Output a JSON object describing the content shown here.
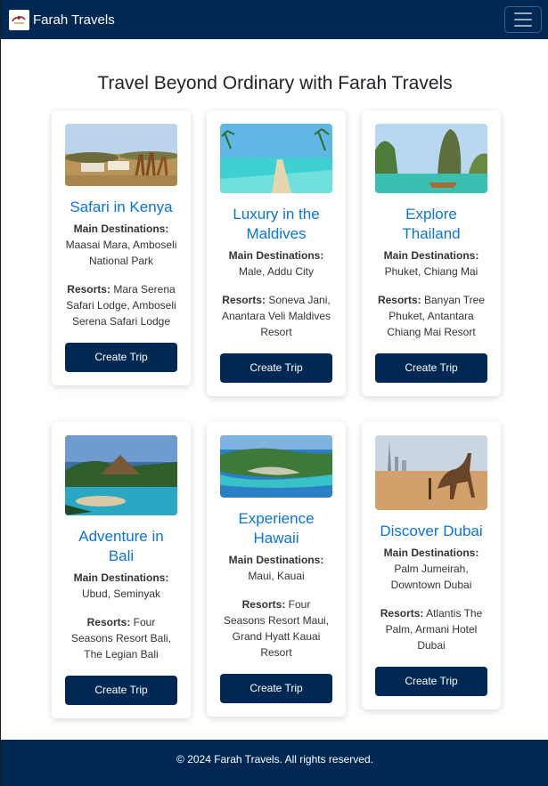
{
  "navbar": {
    "brand": "Farah Travels",
    "toggle_icon": "hamburger-icon"
  },
  "page_title": "Travel Beyond Ordinary with Farah Travels",
  "destinations": [
    {
      "title": "Safari in Kenya",
      "image": "safari-image",
      "dest_label": "Main Destinations:",
      "destinations": "Maasai Mara, Amboseli National Park",
      "resorts_label": "Resorts:",
      "resorts": "Mara Serena Safari Lodge, Amboseli Serena Safari Lodge",
      "button": "Create Trip"
    },
    {
      "title": "Luxury in the Maldives",
      "image": "maldives-image",
      "dest_label": "Main Destinations:",
      "destinations": "Male, Addu City",
      "resorts_label": "Resorts:",
      "resorts": "Soneva Jani, Anantara Veli Maldives Resort",
      "button": "Create Trip"
    },
    {
      "title": "Explore Thailand",
      "image": "thailand-image",
      "dest_label": "Main Destinations:",
      "destinations": "Phuket, Chiang Mai",
      "resorts_label": "Resorts:",
      "resorts": "Banyan Tree Phuket, Antantara Chiang Mai Resort",
      "button": "Create Trip"
    },
    {
      "title": "Adventure in Bali",
      "image": "bali-image",
      "dest_label": "Main Destinations:",
      "destinations": "Ubud, Seminyak",
      "resorts_label": "Resorts:",
      "resorts": "Four Seasons Resort Bali, The Legian Bali",
      "button": "Create Trip"
    },
    {
      "title": "Experience Hawaii",
      "image": "hawaii-image",
      "dest_label": "Main Destinations:",
      "destinations": "Maui, Kauai",
      "resorts_label": "Resorts:",
      "resorts": "Four Seasons Resort Maui, Grand Hyatt Kauai Resort",
      "button": "Create Trip"
    },
    {
      "title": "Discover Dubai",
      "image": "dubai-image",
      "dest_label": "Main Destinations:",
      "destinations": "Palm Jumeirah, Downtown Dubai",
      "resorts_label": "Resorts:",
      "resorts": "Atlantis The Palm, Armani Hotel Dubai",
      "button": "Create Trip"
    }
  ],
  "footer": {
    "text": "© 2024 Farah Travels. All rights reserved."
  },
  "colors": {
    "navy": "#002855",
    "link_blue": "#0b74d9"
  }
}
